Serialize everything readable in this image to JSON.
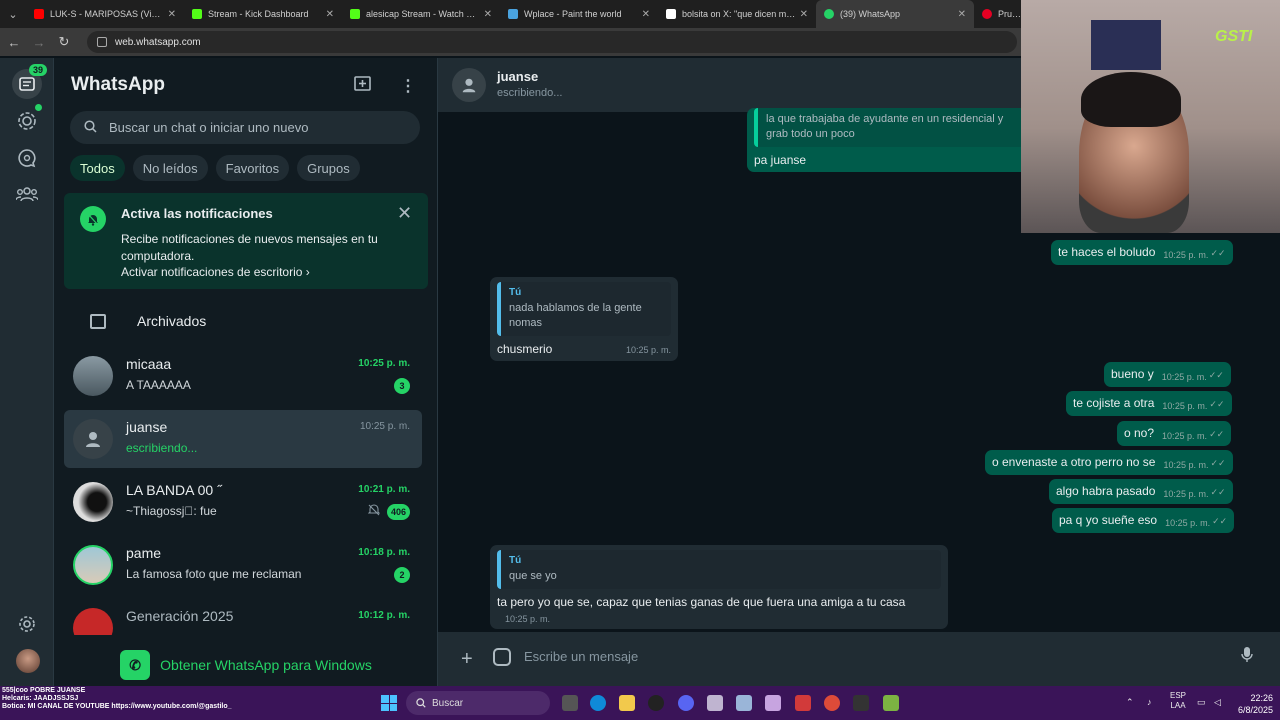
{
  "browser": {
    "tabs": [
      {
        "label": "LUK-S - MARIPOSAS (Video Of",
        "color": "#ff0000"
      },
      {
        "label": "Stream - Kick Dashboard",
        "color": "#53fc18"
      },
      {
        "label": "alesicap Stream - Watch Live o",
        "color": "#53fc18"
      },
      {
        "label": "Wplace - Paint the world",
        "color": "#4aa3df"
      },
      {
        "label": "bolsita on X: \"que dicen me sac",
        "color": "#ffffff"
      },
      {
        "label": "(39) WhatsApp",
        "color": "#25d366"
      },
      {
        "label": "Prueba",
        "color": "#e60023"
      }
    ],
    "url": "web.whatsapp.com"
  },
  "rail": {
    "chats_badge": "39"
  },
  "sidebar": {
    "title": "WhatsApp",
    "search_placeholder": "Buscar un chat o iniciar uno nuevo",
    "filters": [
      "Todos",
      "No leídos",
      "Favoritos",
      "Grupos"
    ],
    "notification": {
      "title": "Activa las notificaciones",
      "body": "Recibe notificaciones de nuevos mensajes en tu computadora.",
      "link": "Activar notificaciones de escritorio",
      "link_chevron": "›"
    },
    "archived_label": "Archivados",
    "chats": [
      {
        "name": "micaaa",
        "preview": "A TAAAAAA",
        "time": "10:25 p. m.",
        "badge": "3"
      },
      {
        "name": "juanse",
        "preview": "escribiendo...",
        "time": "10:25 p. m.",
        "badge": ""
      },
      {
        "name": "LA BANDA 00 ˝",
        "preview": "~Thiagossj🏽: fue",
        "time": "10:21 p. m.",
        "badge": "406"
      },
      {
        "name": "pame",
        "preview": "La famosa foto que me reclaman",
        "time": "10:18 p. m.",
        "badge": "2"
      },
      {
        "name": "Generación 2025",
        "preview": "",
        "time": "10:12 p. m.",
        "badge": ""
      }
    ],
    "get_app": "Obtener WhatsApp para Windows"
  },
  "conversation": {
    "contact": "juanse",
    "status": "escribiendo...",
    "messages": {
      "m1_quote": "la que trabajaba de ayudante en un residencial y grab todo un poco",
      "m1_text": "pa juanse",
      "m2_text": "te haces el boludo",
      "m2_time": "10:25 p. m.",
      "m3_quote_author": "Tú",
      "m3_quote": "nada hablamos de la gente nomas",
      "m3_text": "chusmerio",
      "m3_time": "10:25 p. m.",
      "m4_text": "bueno y",
      "m5_text": "te cojiste a otra",
      "m6_text": "o no?",
      "m7_text": "o envenaste a otro perro no se",
      "m8_text": "algo habra pasado",
      "m9_text": "pa q yo sueñe eso",
      "out_time": "10:25 p. m.",
      "m10_quote_author": "Tú",
      "m10_quote": "que se yo",
      "m10_text": "ta pero yo que se, capaz que tenias ganas de que fuera una amiga a tu casa",
      "m10_time": "10:25 p. m."
    },
    "composer_placeholder": "Escribe un mensaje"
  },
  "overlay": {
    "logo": "GSTI",
    "ticker": [
      "555|coo POBRE JUANSE",
      "Helcaris: JAADJSSJSJ",
      "Botica: MI CANAL DE YOUTUBE https://www.youtube.com/@gastilo_"
    ]
  },
  "taskbar": {
    "search": "Buscar",
    "lang_top": "ESP",
    "lang_bottom": "LAA",
    "time": "22:26",
    "date": "6/8/2025"
  }
}
